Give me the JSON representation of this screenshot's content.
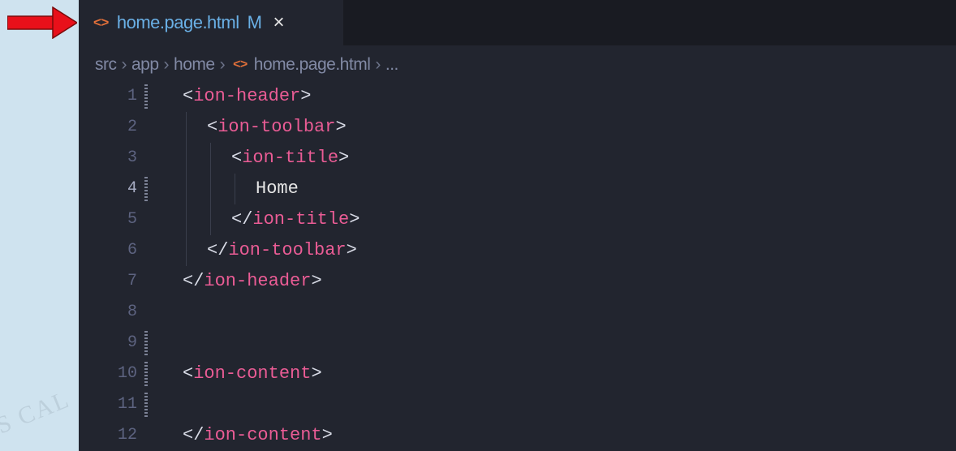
{
  "tab": {
    "filename": "home.page.html",
    "status": "M",
    "close": "×"
  },
  "breadcrumb": [
    "src",
    "app",
    "home",
    "home.page.html",
    "..."
  ],
  "lines": [
    {
      "num": "1",
      "indent": 0,
      "open": "<",
      "tag": "ion-header",
      "close": ">"
    },
    {
      "num": "2",
      "indent": 1,
      "open": "<",
      "tag": "ion-toolbar",
      "close": ">"
    },
    {
      "num": "3",
      "indent": 2,
      "open": "<",
      "tag": "ion-title",
      "close": ">"
    },
    {
      "num": "4",
      "indent": 3,
      "text": "Home"
    },
    {
      "num": "5",
      "indent": 2,
      "open": "</",
      "tag": "ion-title",
      "close": ">"
    },
    {
      "num": "6",
      "indent": 1,
      "open": "</",
      "tag": "ion-toolbar",
      "close": ">"
    },
    {
      "num": "7",
      "indent": 0,
      "open": "</",
      "tag": "ion-header",
      "close": ">"
    },
    {
      "num": "8"
    },
    {
      "num": "9"
    },
    {
      "num": "10",
      "indent": 0,
      "open": "<",
      "tag": "ion-content",
      "close": ">"
    },
    {
      "num": "11"
    },
    {
      "num": "12",
      "indent": 0,
      "open": "</",
      "tag": "ion-content",
      "close": ">"
    }
  ],
  "watermark": "S CAL",
  "colors": {
    "tag": "#ea5c95",
    "bracket": "#d8dbe6",
    "tab_name": "#6ab0e6",
    "file_icon": "#e2703a",
    "arrow": "#e8101a"
  }
}
